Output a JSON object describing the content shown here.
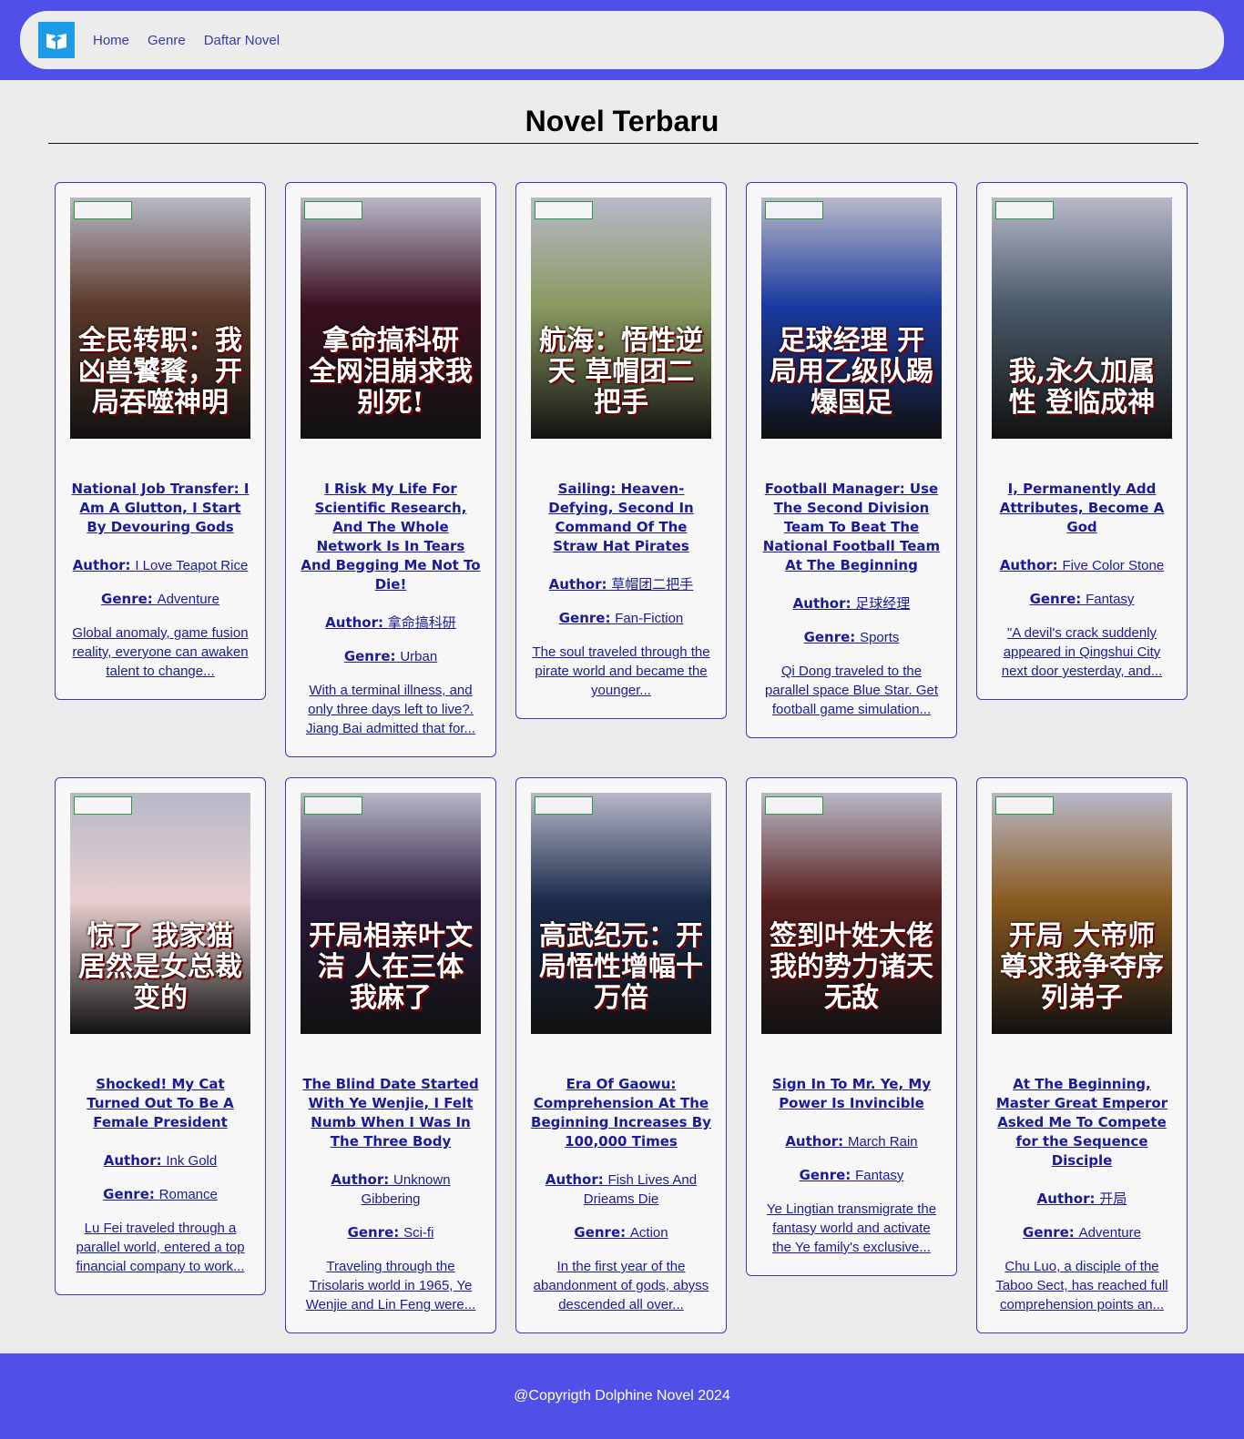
{
  "nav": {
    "logo_icon": "book-logo-icon",
    "links": [
      "Home",
      "Genre",
      "Daftar Novel"
    ]
  },
  "page": {
    "title": "Novel Terbaru"
  },
  "novels": [
    {
      "cover_text": "全民转职：我凶兽饕餮，开局吞噬神明",
      "cover_color": "#5a3a2a",
      "title": "National Job Transfer: I Am A Glutton, I Start By Devouring Gods",
      "author_label": "Author:",
      "author": "I Love Teapot Rice",
      "genre_label": "Genre:",
      "genre": "Adventure",
      "desc": "Global anomaly, game fusion reality, everyone can awaken talent to change..."
    },
    {
      "cover_text": "拿命搞科研 全网泪崩求我别死!",
      "cover_color": "#3a1020",
      "title": "I Risk My Life For Scientific Research, And The Whole Network Is In Tears And Begging Me Not To Die!",
      "author_label": "Author:",
      "author": "拿命搞科研",
      "genre_label": "Genre:",
      "genre": "Urban",
      "desc": "With a terminal illness, and only three days left to live?. Jiang Bai admitted that for..."
    },
    {
      "cover_text": "航海：悟性逆天 草帽团二把手",
      "cover_color": "#8a9a60",
      "title": "Sailing: Heaven-Defying, Second In Command Of The Straw Hat Pirates",
      "author_label": "Author:",
      "author": "草帽团二把手",
      "genre_label": "Genre:",
      "genre": "Fan-Fiction",
      "desc": "The soul traveled through the pirate world and became the younger..."
    },
    {
      "cover_text": "足球经理 开局用乙级队踢爆国足",
      "cover_color": "#1a3aa0",
      "title": "Football Manager: Use The Second Division Team To Beat The National Football Team At The Beginning",
      "author_label": "Author:",
      "author": "足球经理",
      "genre_label": "Genre:",
      "genre": "Sports",
      "desc": "Qi Dong traveled to the parallel space Blue Star. Get football game simulation..."
    },
    {
      "cover_text": "我,永久加属性 登临成神",
      "cover_color": "#4a5a6a",
      "title": "I, Permanently Add Attributes, Become A God",
      "author_label": "Author:",
      "author": "Five Color Stone",
      "genre_label": "Genre:",
      "genre": "Fantasy",
      "desc": "\"A devil's crack suddenly appeared in Qingshui City next door yesterday, and..."
    },
    {
      "cover_text": "惊了 我家猫居然是女总裁变的",
      "cover_color": "#e8d0d0",
      "title": "Shocked! My Cat Turned Out To Be A Female President",
      "author_label": "Author:",
      "author": "Ink Gold",
      "genre_label": "Genre:",
      "genre": "Romance",
      "desc": "Lu Fei traveled through a parallel world, entered a top financial company to work..."
    },
    {
      "cover_text": "开局相亲叶文洁 人在三体我麻了",
      "cover_color": "#2a1a3a",
      "title": "The Blind Date Started With Ye Wenjie, I Felt Numb When I Was In The Three Body",
      "author_label": "Author:",
      "author": "Unknown Gibbering",
      "genre_label": "Genre:",
      "genre": "Sci-fi",
      "desc": "Traveling through the Trisolaris world in 1965, Ye Wenjie and Lin Feng were..."
    },
    {
      "cover_text": "高武纪元：开局悟性增幅十万倍",
      "cover_color": "#1a2a4a",
      "title": "Era Of Gaowu: Comprehension At The Beginning Increases By 100,000 Times",
      "author_label": "Author:",
      "author": "Fish Lives And Drieams Die",
      "genre_label": "Genre:",
      "genre": "Action",
      "desc": "In the first year of the abandonment of gods, abyss descended all over..."
    },
    {
      "cover_text": "签到叶姓大佬 我的势力诸天无敌",
      "cover_color": "#5a2020",
      "title": "Sign In To Mr. Ye, My Power Is Invincible",
      "author_label": "Author:",
      "author": "March Rain",
      "genre_label": "Genre:",
      "genre": "Fantasy",
      "desc": "Ye Lingtian transmigrate the fantasy world and activate the Ye family's exclusive..."
    },
    {
      "cover_text": "开局 大帝师尊求我争夺序列弟子",
      "cover_color": "#8a5a20",
      "title": "At The Beginning, Master Great Emperor Asked Me To Compete for the Sequence Disciple",
      "author_label": "Author:",
      "author": "开局",
      "genre_label": "Genre:",
      "genre": "Adventure",
      "desc": "Chu Luo, a disciple of the Taboo Sect, has reached full comprehension points an..."
    }
  ],
  "footer": {
    "text": "@Copyrigth Dolphine Novel 2024"
  }
}
